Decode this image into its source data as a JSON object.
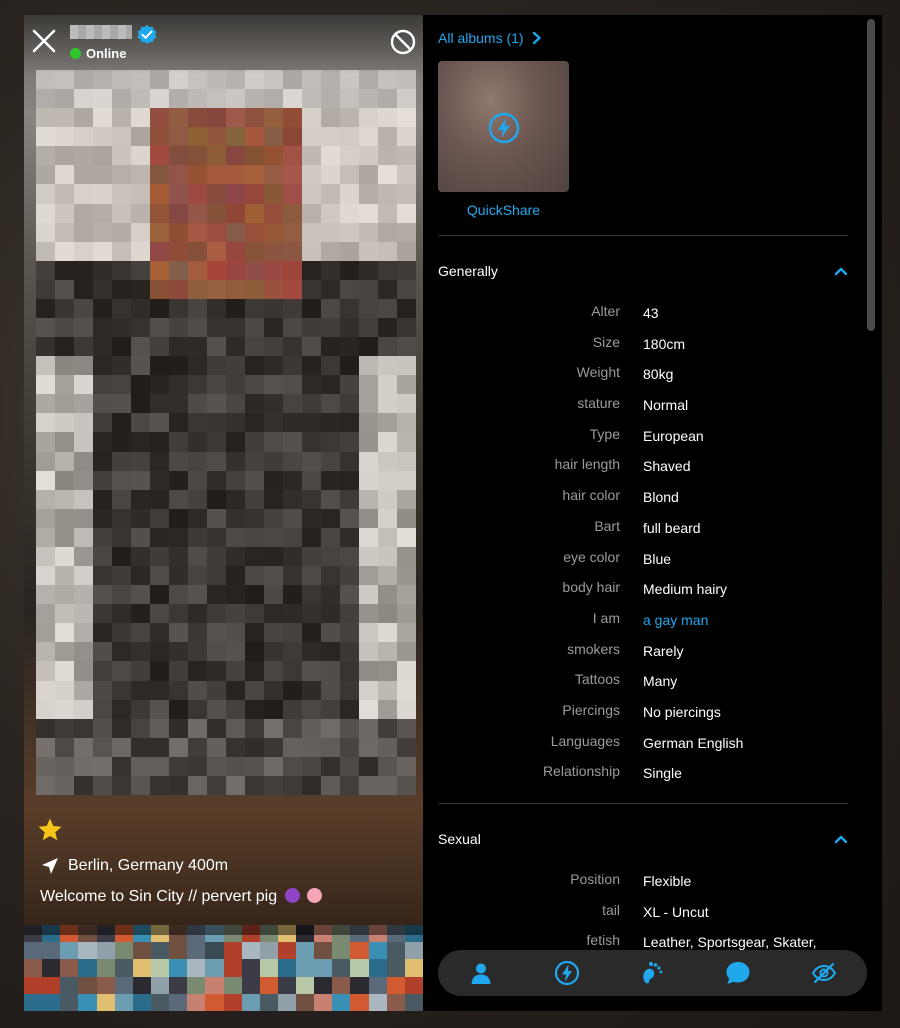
{
  "profile": {
    "status": "Online",
    "location": "Berlin, Germany 400m",
    "headline": "Welcome to Sin City // pervert pig"
  },
  "albums": {
    "link_label": "All albums (1)",
    "thumb_label": "QuickShare"
  },
  "generally": {
    "title": "Generally",
    "rows": [
      {
        "label": "Alter",
        "value": "43"
      },
      {
        "label": "Size",
        "value": "180cm"
      },
      {
        "label": "Weight",
        "value": "80kg"
      },
      {
        "label": "stature",
        "value": "Normal"
      },
      {
        "label": "Type",
        "value": "European"
      },
      {
        "label": "hair length",
        "value": "Shaved"
      },
      {
        "label": "hair color",
        "value": "Blond"
      },
      {
        "label": "Bart",
        "value": "full beard"
      },
      {
        "label": "eye color",
        "value": "Blue"
      },
      {
        "label": "body hair",
        "value": "Medium hairy"
      },
      {
        "label": "I am",
        "value": "a gay man"
      },
      {
        "label": "smokers",
        "value": "Rarely"
      },
      {
        "label": "Tattoos",
        "value": "Many"
      },
      {
        "label": "Piercings",
        "value": "No piercings"
      },
      {
        "label": "Languages",
        "value": "German English"
      },
      {
        "label": "Relationship",
        "value": "Single"
      }
    ]
  },
  "sexual": {
    "title": "Sexual",
    "rows": [
      {
        "label": "Position",
        "value": "Flexible"
      },
      {
        "label": "tail",
        "value": "XL - Uncut"
      },
      {
        "label": "fetish",
        "value": "Leather, Sportsgear, Skater,"
      }
    ]
  },
  "colors": {
    "accent": "#20a8ee",
    "online": "#2ec82e",
    "star": "#f5c518",
    "label": "#9b9b9b",
    "action_bar": "#2a2a2a"
  },
  "icons": {
    "close": "close-icon",
    "verified": "verified-badge-icon",
    "block": "block-icon",
    "favorite": "star-icon",
    "location": "location-arrow-icon",
    "albums_chevron": "chevron-right-icon",
    "quickshare": "lightning-icon",
    "section_toggle": "chevron-up-icon",
    "action_bar": [
      "profile-icon",
      "lightning-icon",
      "footprint-icon",
      "chat-icon",
      "hide-icon"
    ]
  }
}
